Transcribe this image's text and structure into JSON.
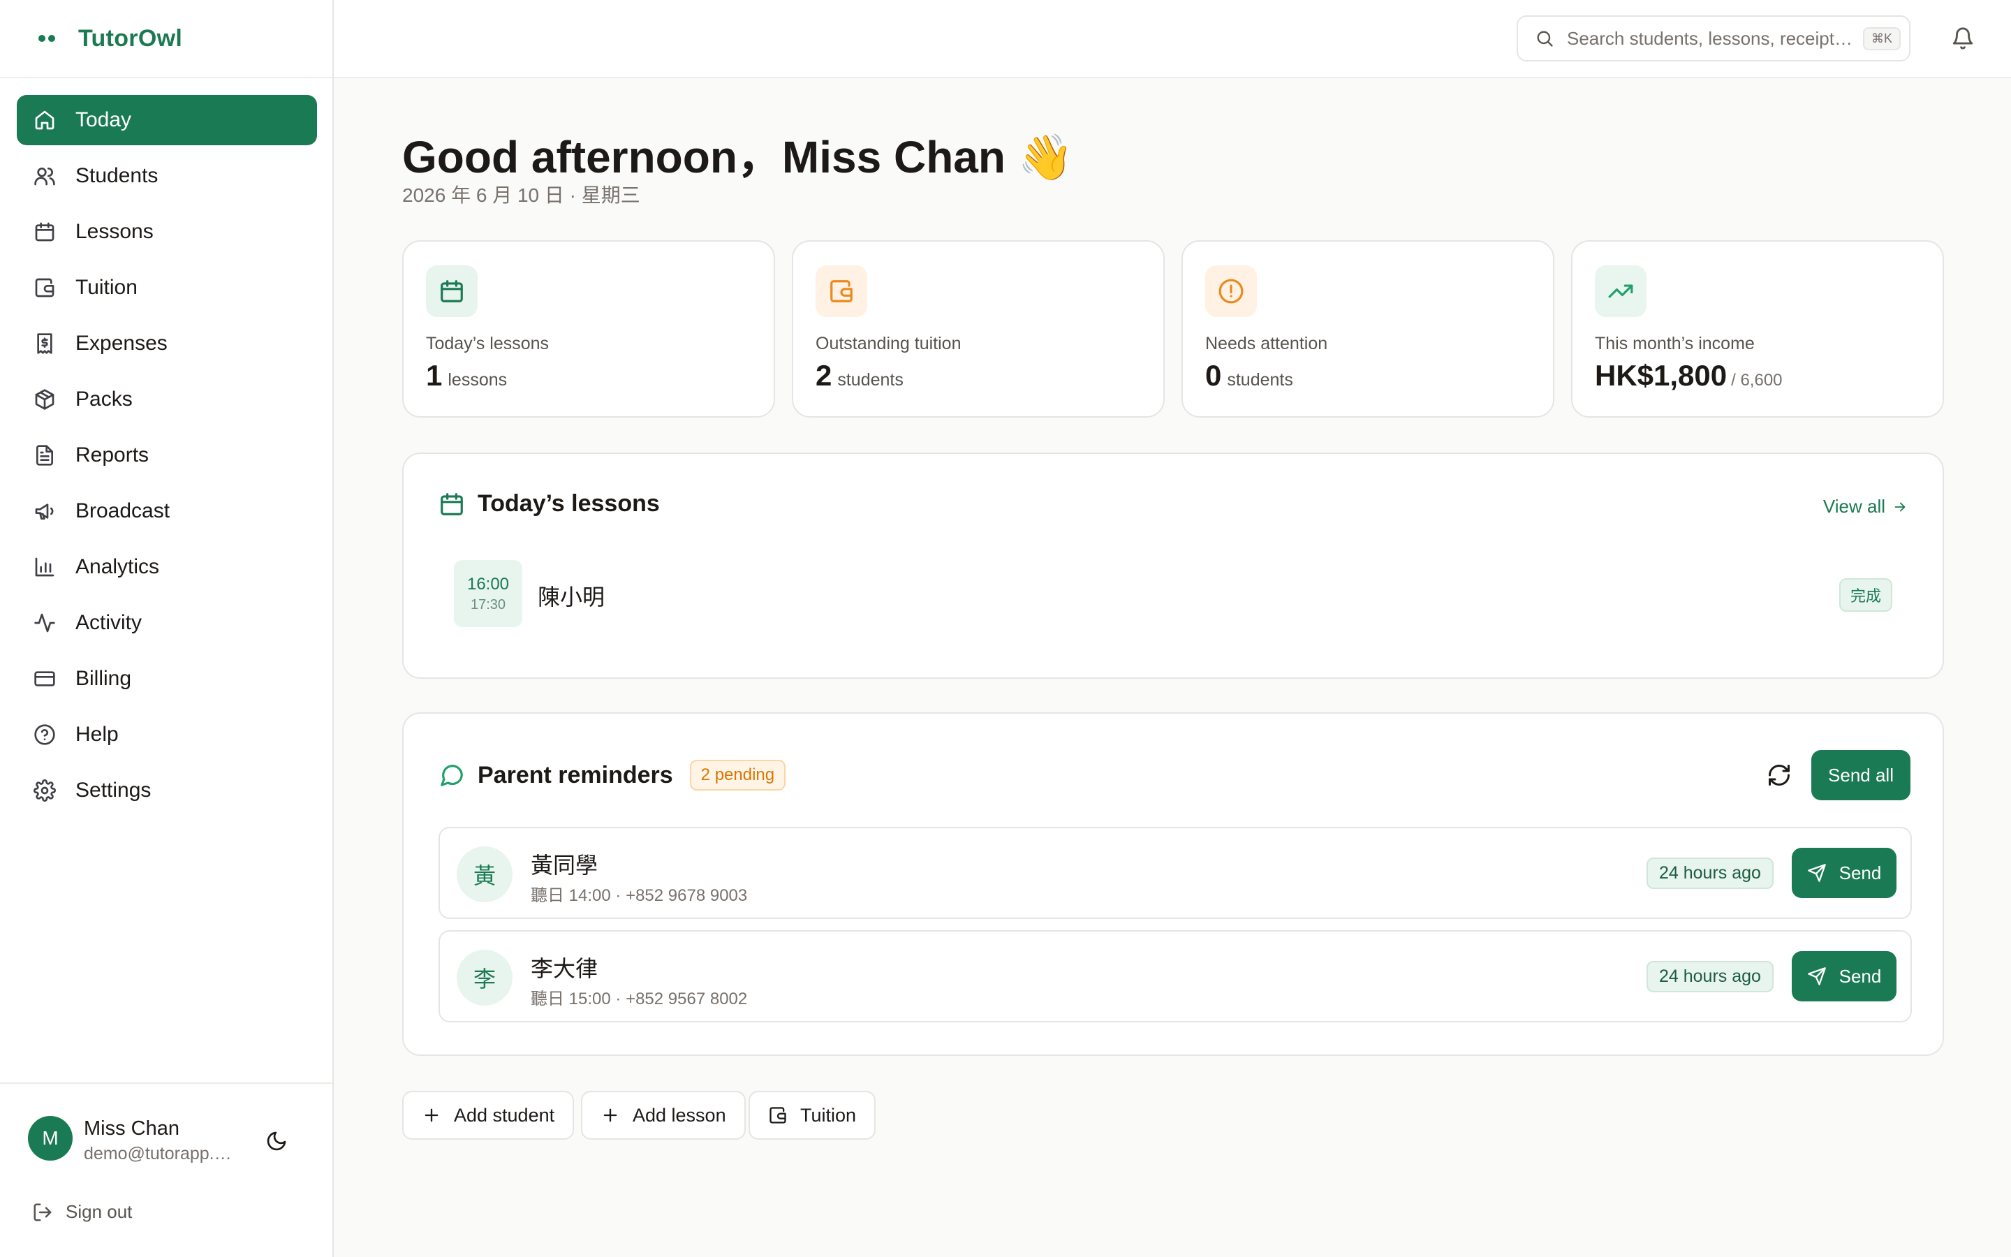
{
  "app": {
    "name": "TutorOwl"
  },
  "sidebar": {
    "items": [
      {
        "label": "Today",
        "icon": "home-icon",
        "active": true
      },
      {
        "label": "Students",
        "icon": "users-icon"
      },
      {
        "label": "Lessons",
        "icon": "calendar-icon"
      },
      {
        "label": "Tuition",
        "icon": "wallet-icon"
      },
      {
        "label": "Expenses",
        "icon": "receipt-icon"
      },
      {
        "label": "Packs",
        "icon": "package-icon"
      },
      {
        "label": "Reports",
        "icon": "file-text-icon"
      },
      {
        "label": "Broadcast",
        "icon": "megaphone-icon"
      },
      {
        "label": "Analytics",
        "icon": "bar-chart-icon"
      },
      {
        "label": "Activity",
        "icon": "activity-icon"
      },
      {
        "label": "Billing",
        "icon": "credit-card-icon"
      },
      {
        "label": "Help",
        "icon": "help-circle-icon"
      },
      {
        "label": "Settings",
        "icon": "gear-icon"
      }
    ],
    "user": {
      "initial": "M",
      "name": "Miss Chan",
      "email": "demo@tutorapp.com"
    },
    "sign_out": "Sign out"
  },
  "topbar": {
    "search_placeholder": "Search students, lessons, receipts...",
    "shortcut": "⌘K"
  },
  "header": {
    "greeting": "Good afternoon，Miss Chan 👋",
    "date": "2026 年 6 月 10 日 · 星期三"
  },
  "stats": [
    {
      "label": "Today’s lessons",
      "value": "1",
      "unit": "lessons",
      "icon": "calendar-icon",
      "accent": "#1a7a53"
    },
    {
      "label": "Outstanding tuition",
      "value": "2",
      "unit": "students",
      "icon": "wallet-icon",
      "accent": "#ea8a1e"
    },
    {
      "label": "Needs attention",
      "value": "0",
      "unit": "students",
      "icon": "alert-circle-icon",
      "accent": "#ea8a1e"
    },
    {
      "label": "This month’s income",
      "value": "HK$1,800",
      "sub": "/ 6,600",
      "icon": "trending-up-icon",
      "accent": "#22a06b"
    }
  ],
  "lessons_card": {
    "title": "Today’s lessons",
    "view_all": "View all",
    "lessons": [
      {
        "start": "16:00",
        "end": "17:30",
        "student": "陳小明",
        "status": "完成"
      }
    ]
  },
  "reminders_card": {
    "title": "Parent reminders",
    "badge": "2 pending",
    "send_all": "Send all",
    "items": [
      {
        "initial": "黃",
        "name": "黃同學",
        "schedule": "聽日 14:00",
        "phone": "+852 9678 9003",
        "ago": "24 hours ago",
        "send": "Send"
      },
      {
        "initial": "李",
        "name": "李大律",
        "schedule": "聽日 15:00",
        "phone": "+852 9567 8002",
        "ago": "24 hours ago",
        "send": "Send"
      }
    ]
  },
  "quick_actions": [
    {
      "label": "Add student",
      "icon": "plus-icon"
    },
    {
      "label": "Add lesson",
      "icon": "plus-icon"
    },
    {
      "label": "Tuition",
      "icon": "wallet-icon"
    }
  ],
  "colors": {
    "brand": "#1a7a53",
    "warning": "#ea8a1e"
  }
}
